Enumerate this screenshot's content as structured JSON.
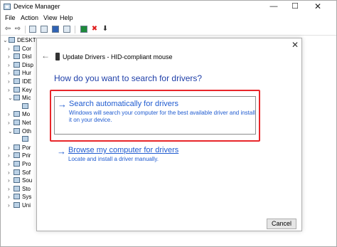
{
  "window": {
    "title": "Device Manager",
    "controls": [
      "—",
      "☐",
      "✕"
    ]
  },
  "menu": [
    "File",
    "Action",
    "View",
    "Help"
  ],
  "toolbar": {
    "back_icon": "back-arrow-icon",
    "forward_icon": "forward-arrow-icon",
    "buttons": [
      "properties-icon",
      "show-hidden-icon",
      "help-icon",
      "scan-icon",
      "update-driver-icon",
      "uninstall-icon",
      "download-icon"
    ],
    "glyphs": {
      "back": "⇦",
      "forward": "⇨",
      "uninstall": "✖",
      "download": "⬇"
    },
    "uninstall_color": "#e02020",
    "update_color": "#1d8a3a"
  },
  "tree": [
    {
      "label": "DESKTOP",
      "expander": "⌄",
      "level": 0
    },
    {
      "label": "Cor",
      "expander": "›",
      "level": 1
    },
    {
      "label": "Disl",
      "expander": "›",
      "level": 1
    },
    {
      "label": "Disp",
      "expander": "›",
      "level": 1
    },
    {
      "label": "Hur",
      "expander": "›",
      "level": 1
    },
    {
      "label": "IDE",
      "expander": "›",
      "level": 1
    },
    {
      "label": "Key",
      "expander": "›",
      "level": 1
    },
    {
      "label": "Mic",
      "expander": "⌄",
      "level": 1
    },
    {
      "label": "",
      "expander": "",
      "level": 2
    },
    {
      "label": "Mo",
      "expander": "›",
      "level": 1
    },
    {
      "label": "Net",
      "expander": "›",
      "level": 1
    },
    {
      "label": "Oth",
      "expander": "⌄",
      "level": 1
    },
    {
      "label": "",
      "expander": "",
      "level": 2
    },
    {
      "label": "Por",
      "expander": "›",
      "level": 1
    },
    {
      "label": "Prir",
      "expander": "›",
      "level": 1
    },
    {
      "label": "Pro",
      "expander": "›",
      "level": 1
    },
    {
      "label": "Sof",
      "expander": "›",
      "level": 1
    },
    {
      "label": "Sou",
      "expander": "›",
      "level": 1
    },
    {
      "label": "Sto",
      "expander": "›",
      "level": 1
    },
    {
      "label": "Sys",
      "expander": "›",
      "level": 1
    },
    {
      "label": "Uni",
      "expander": "›",
      "level": 1
    }
  ],
  "dialog": {
    "back_glyph": "←",
    "close_glyph": "✕",
    "title": "Update Drivers - HID-compliant mouse",
    "heading": "How do you want to search for drivers?",
    "option_arrow": "→",
    "option1": {
      "title": "Search automatically for drivers",
      "description": "Windows will search your computer for the best available driver and install it on your device."
    },
    "option2": {
      "title": "Browse my computer for drivers",
      "description": "Locate and install a driver manually."
    },
    "cancel_label": "Cancel",
    "accent_color": "#1f5bd0",
    "highlight_color": "#e8262a"
  }
}
